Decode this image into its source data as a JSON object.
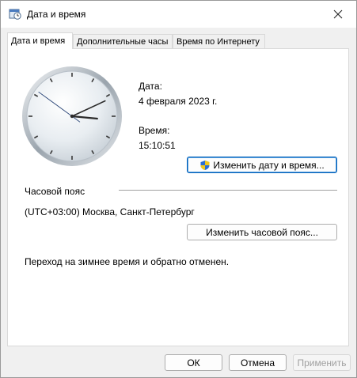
{
  "window": {
    "title": "Дата и время",
    "icon": "clock-calendar-icon"
  },
  "tabs": [
    {
      "label": "Дата и время"
    },
    {
      "label": "Дополнительные часы"
    },
    {
      "label": "Время по Интернету"
    }
  ],
  "clock": {
    "hours": 15,
    "minutes": 10,
    "seconds": 51
  },
  "date": {
    "label": "Дата:",
    "value": "4 февраля 2023 г."
  },
  "time": {
    "label": "Время:",
    "value": "15:10:51"
  },
  "buttons": {
    "change_datetime": "Изменить дату и время...",
    "change_timezone": "Изменить часовой пояс...",
    "ok": "ОК",
    "cancel": "Отмена",
    "apply": "Применить"
  },
  "timezone": {
    "heading": "Часовой пояс",
    "value": "(UTC+03:00) Москва, Санкт-Петербург",
    "dst_note": "Переход на зимнее время и обратно отменен."
  },
  "colors": {
    "accent": "#005fb8",
    "clock_hand_second": "#1f3b70"
  }
}
